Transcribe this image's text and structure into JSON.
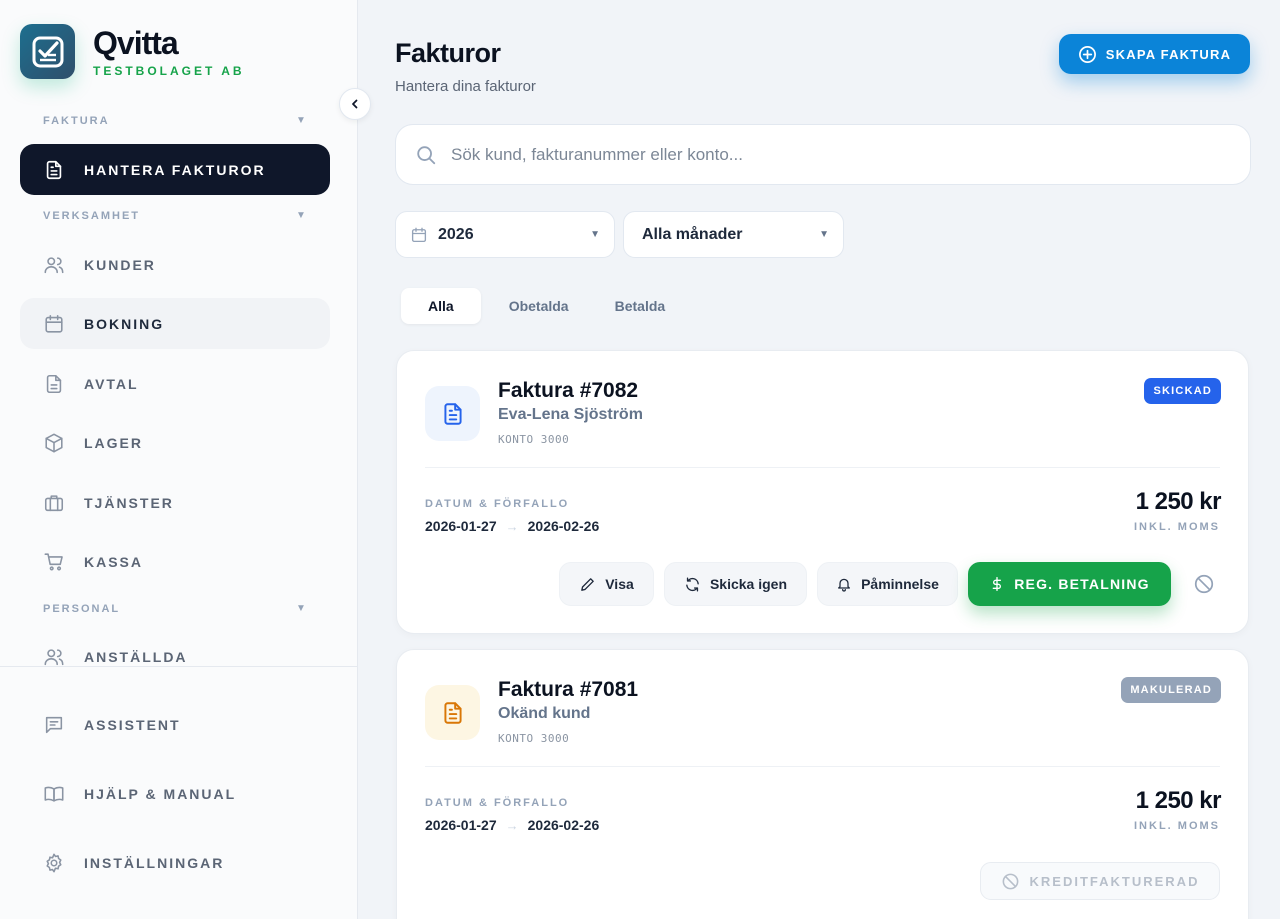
{
  "brand": {
    "name": "Qvitta",
    "company": "TESTBOLAGET AB"
  },
  "sidebar": {
    "sections": [
      {
        "label": "FAKTURA"
      },
      {
        "label": "VERKSAMHET"
      },
      {
        "label": "PERSONAL"
      }
    ],
    "items": [
      {
        "label": "HANTERA FAKTUROR",
        "icon": "document-icon",
        "active": true
      },
      {
        "label": "KUNDER",
        "icon": "users-icon"
      },
      {
        "label": "BOKNING",
        "icon": "calendar-icon"
      },
      {
        "label": "AVTAL",
        "icon": "document-icon"
      },
      {
        "label": "LAGER",
        "icon": "box-icon"
      },
      {
        "label": "TJÄNSTER",
        "icon": "briefcase-icon"
      },
      {
        "label": "KASSA",
        "icon": "cart-icon"
      },
      {
        "label": "ANSTÄLLDA",
        "icon": "users-icon"
      }
    ],
    "bottom": [
      {
        "label": "ASSISTENT",
        "icon": "chat-icon"
      },
      {
        "label": "HJÄLP & MANUAL",
        "icon": "book-icon"
      },
      {
        "label": "INSTÄLLNINGAR",
        "icon": "gear-icon"
      }
    ]
  },
  "header": {
    "title": "Fakturor",
    "subtitle": "Hantera dina fakturor",
    "create_label": "SKAPA FAKTURA"
  },
  "search": {
    "placeholder": "Sök kund, fakturanummer eller konto..."
  },
  "filters": {
    "year": "2026",
    "month": "Alla månader"
  },
  "tabs": [
    {
      "label": "Alla",
      "active": true
    },
    {
      "label": "Obetalda"
    },
    {
      "label": "Betalda"
    }
  ],
  "invoices": [
    {
      "number": "Faktura #7082",
      "customer": "Eva-Lena Sjöström",
      "konto": "KONTO 3000",
      "status": "SKICKAD",
      "status_color": "#2563eb",
      "date_label": "DATUM & FÖRFALLO",
      "date": "2026-01-27",
      "due": "2026-02-26",
      "amount": "1 250 kr",
      "amount_note": "INKL. MOMS",
      "actions": {
        "view": "Visa",
        "resend": "Skicka igen",
        "reminder": "Påminnelse",
        "pay": "REG. BETALNING"
      }
    },
    {
      "number": "Faktura #7081",
      "customer": "Okänd kund",
      "konto": "KONTO 3000",
      "status": "MAKULERAD",
      "status_color": "#94a3b8",
      "date_label": "DATUM & FÖRFALLO",
      "date": "2026-01-27",
      "due": "2026-02-26",
      "amount": "1 250 kr",
      "amount_note": "INKL. MOMS",
      "credit_label": "KREDITFAKTURERAD"
    }
  ]
}
